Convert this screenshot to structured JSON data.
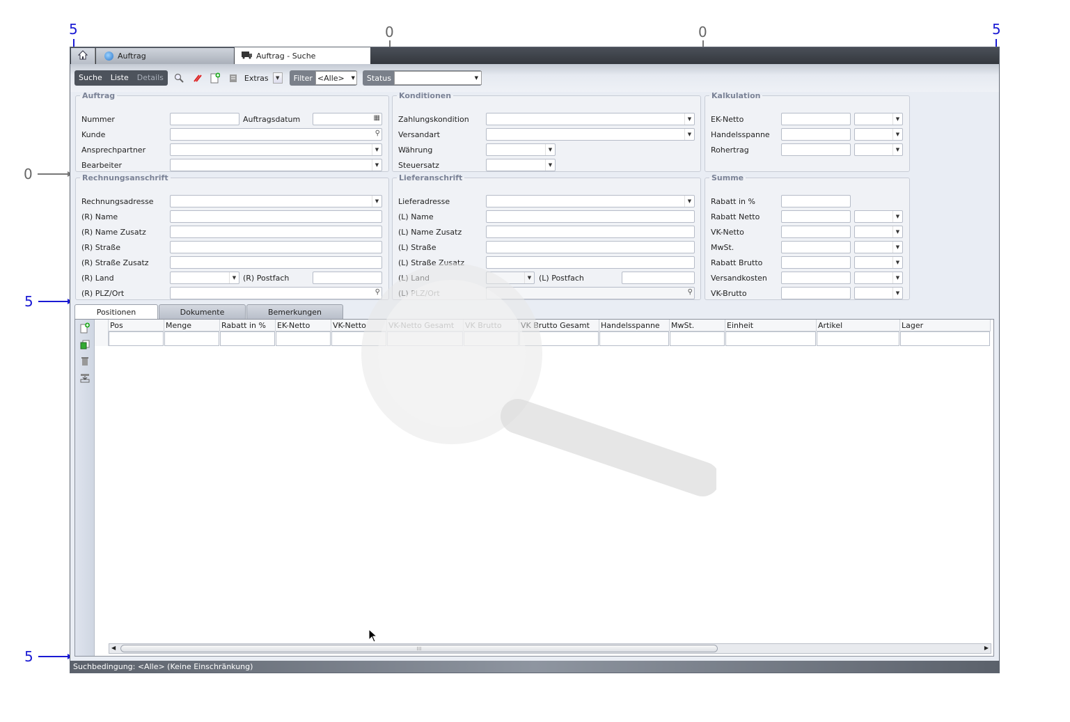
{
  "annotations": {
    "top_left": "5",
    "top_mid1": "0",
    "top_mid2": "0",
    "top_right": "5",
    "left_mid": "0",
    "left_grid": "5",
    "left_bottom": "5"
  },
  "tabs": {
    "auftrag": "Auftrag",
    "suche": "Auftrag - Suche"
  },
  "toolbar": {
    "crumbs": [
      "Suche",
      "Liste",
      "Details"
    ],
    "extras": "Extras",
    "filter_label": "Filter",
    "filter_value": "<Alle>",
    "status_label": "Status",
    "status_value": ""
  },
  "auftrag": {
    "legend": "Auftrag",
    "nummer": "Nummer",
    "auftragsdatum": "Auftragsdatum",
    "kunde": "Kunde",
    "ansprechpartner": "Ansprechpartner",
    "bearbeiter": "Bearbeiter"
  },
  "konditionen": {
    "legend": "Konditionen",
    "zahlungskondition": "Zahlungskondition",
    "versandart": "Versandart",
    "waehrung": "Währung",
    "steuersatz": "Steuersatz"
  },
  "kalkulation": {
    "legend": "Kalkulation",
    "ek_netto": "EK-Netto",
    "handelsspanne": "Handelsspanne",
    "rohertrag": "Rohertrag"
  },
  "rechnung": {
    "legend": "Rechnungsanschrift",
    "adresse": "Rechnungsadresse",
    "name": "(R) Name",
    "name_zusatz": "(R) Name Zusatz",
    "strasse": "(R) Straße",
    "strasse_zusatz": "(R) Straße Zusatz",
    "land": "(R) Land",
    "postfach": "(R) Postfach",
    "plz_ort": "(R) PLZ/Ort"
  },
  "liefer": {
    "legend": "Lieferanschrift",
    "adresse": "Lieferadresse",
    "name": "(L) Name",
    "name_zusatz": "(L) Name Zusatz",
    "strasse": "(L) Straße",
    "strasse_zusatz": "(L) Straße Zusatz",
    "land": "(L) Land",
    "postfach": "(L) Postfach",
    "plz_ort": "(L) PLZ/Ort"
  },
  "summe": {
    "legend": "Summe",
    "rabatt_prozent": "Rabatt in %",
    "rabatt_netto": "Rabatt Netto",
    "vk_netto": "VK-Netto",
    "mwst": "MwSt.",
    "rabatt_brutto": "Rabatt Brutto",
    "versandkosten": "Versandkosten",
    "vk_brutto": "VK-Brutto"
  },
  "subtabs": [
    "Positionen",
    "Dokumente",
    "Bemerkungen"
  ],
  "grid": {
    "columns": [
      "Pos",
      "Menge",
      "Rabatt in %",
      "EK-Netto",
      "VK-Netto",
      "VK-Netto Gesamt",
      "VK Brutto",
      "VK Brutto Gesamt",
      "Handelsspanne",
      "MwSt.",
      "Einheit",
      "Artikel",
      "Lager"
    ]
  },
  "statusbar": "Suchbedingung: <Alle> (Keine Einschränkung)"
}
